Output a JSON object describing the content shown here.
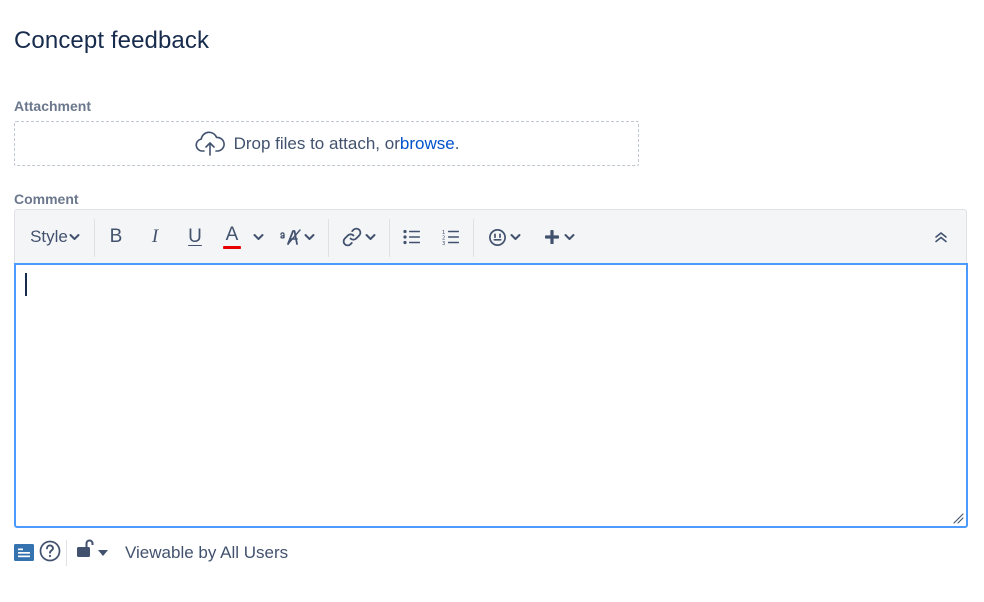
{
  "page": {
    "title": "Concept feedback"
  },
  "attachment": {
    "label": "Attachment",
    "drop_text": "Drop files to attach, or ",
    "browse_link": "browse",
    "drop_text_end": "."
  },
  "comment": {
    "label": "Comment",
    "value": "",
    "toolbar": {
      "style_label": "Style",
      "bold_label": "B",
      "italic_label": "I",
      "underline_label": "U",
      "text_color_label": "A",
      "text_color": "#e60000"
    }
  },
  "footer": {
    "viewable_text": "Viewable by All Users"
  },
  "colors": {
    "accent": "#4c9aff",
    "link": "#0052cc",
    "icon": "#42526e",
    "text": "#172b4d"
  }
}
